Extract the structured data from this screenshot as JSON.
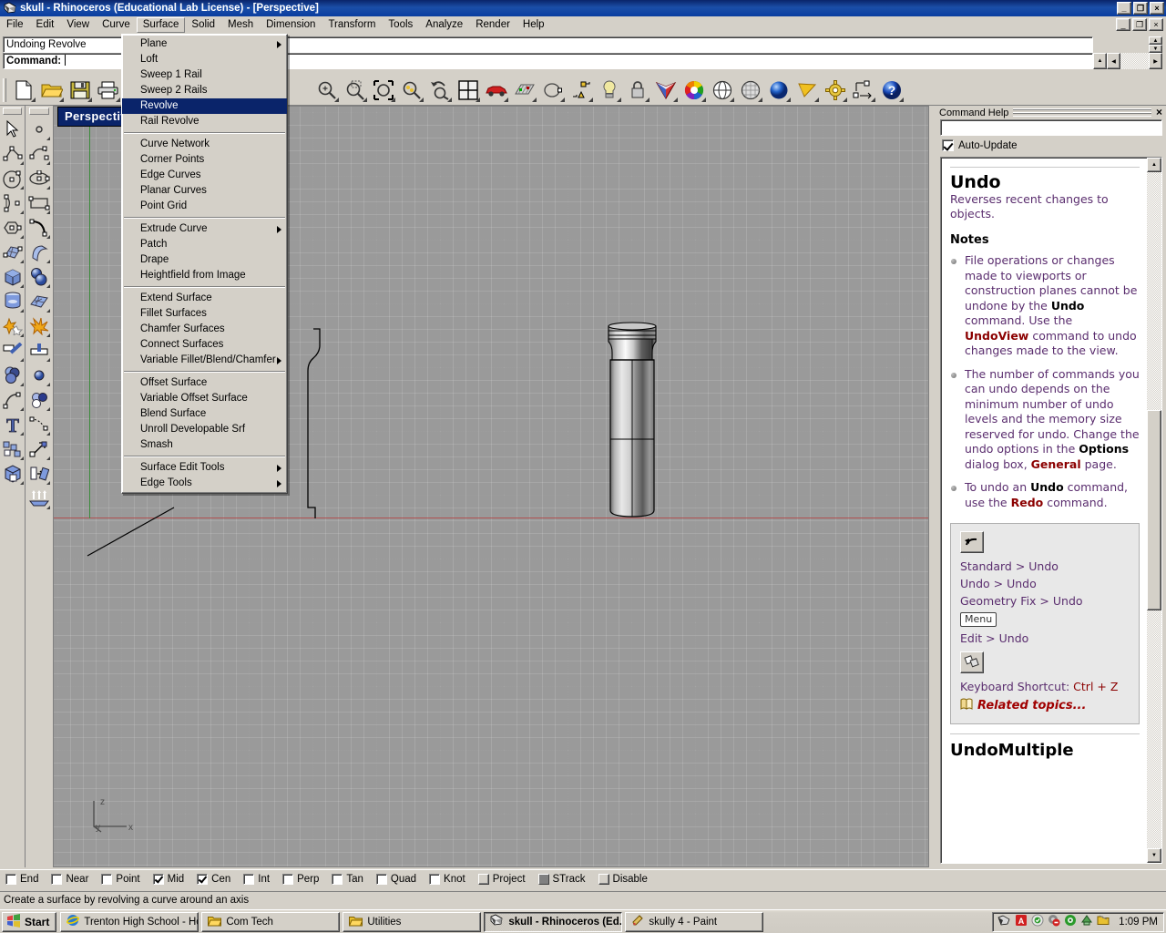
{
  "window": {
    "title": "skull - Rhinoceros (Educational Lab License) - [Perspective]",
    "minimize_label": "_",
    "restore_label": "❐",
    "close_label": "×",
    "mdi_minimize_label": "_",
    "mdi_restore_label": "❐",
    "mdi_close_label": "×"
  },
  "menubar": {
    "items": [
      {
        "label": "File"
      },
      {
        "label": "Edit"
      },
      {
        "label": "View"
      },
      {
        "label": "Curve"
      },
      {
        "label": "Surface",
        "active": true
      },
      {
        "label": "Solid"
      },
      {
        "label": "Mesh"
      },
      {
        "label": "Dimension"
      },
      {
        "label": "Transform"
      },
      {
        "label": "Tools"
      },
      {
        "label": "Analyze"
      },
      {
        "label": "Render"
      },
      {
        "label": "Help"
      }
    ]
  },
  "surface_menu": {
    "items": [
      {
        "label": "Plane",
        "submenu": true
      },
      {
        "label": "Loft"
      },
      {
        "label": "Sweep 1 Rail"
      },
      {
        "label": "Sweep 2 Rails"
      },
      {
        "label": "Revolve",
        "selected": true
      },
      {
        "label": "Rail Revolve"
      },
      {
        "separator": true
      },
      {
        "label": "Curve Network"
      },
      {
        "label": "Corner Points"
      },
      {
        "label": "Edge Curves"
      },
      {
        "label": "Planar Curves"
      },
      {
        "label": "Point Grid"
      },
      {
        "separator": true
      },
      {
        "label": "Extrude Curve",
        "submenu": true
      },
      {
        "label": "Patch"
      },
      {
        "label": "Drape"
      },
      {
        "label": "Heightfield from Image"
      },
      {
        "separator": true
      },
      {
        "label": "Extend Surface"
      },
      {
        "label": "Fillet Surfaces"
      },
      {
        "label": "Chamfer Surfaces"
      },
      {
        "label": "Connect Surfaces"
      },
      {
        "label": "Variable Fillet/Blend/Chamfer",
        "submenu": true
      },
      {
        "separator": true
      },
      {
        "label": "Offset Surface"
      },
      {
        "label": "Variable Offset Surface"
      },
      {
        "label": "Blend Surface"
      },
      {
        "label": "Unroll Developable Srf"
      },
      {
        "label": "Smash"
      },
      {
        "separator": true
      },
      {
        "label": "Surface Edit Tools",
        "submenu": true
      },
      {
        "label": "Edge Tools",
        "submenu": true
      }
    ]
  },
  "command": {
    "history": "Undoing Revolve",
    "prompt": "Command:",
    "input_value": ""
  },
  "toolbar": {
    "buttons": [
      {
        "icon": "new-file-icon"
      },
      {
        "icon": "open-folder-icon"
      },
      {
        "icon": "save-icon"
      },
      {
        "icon": "print-icon"
      },
      {
        "icon": "copy-icon"
      },
      {
        "icon": "cut-icon"
      },
      {
        "icon": "paste-icon"
      },
      {
        "icon": "undo-icon"
      },
      {
        "icon": "redo-icon"
      },
      {
        "icon": "zoom-in-out-icon"
      },
      {
        "icon": "zoom-window-icon"
      },
      {
        "icon": "zoom-extents-icon"
      },
      {
        "icon": "zoom-selected-icon"
      },
      {
        "icon": "zoom-previous-icon"
      },
      {
        "icon": "four-view-icon"
      },
      {
        "icon": "car-render-icon"
      },
      {
        "icon": "grid-snap-icon"
      },
      {
        "icon": "osnap-icon"
      },
      {
        "icon": "layer-icon"
      },
      {
        "icon": "light-bulb-icon"
      },
      {
        "icon": "lock-icon"
      },
      {
        "icon": "shade-icon"
      },
      {
        "icon": "color-wheel-icon"
      },
      {
        "icon": "wireframe-sphere-icon"
      },
      {
        "icon": "ghosted-sphere-icon"
      },
      {
        "icon": "rendered-sphere-icon"
      },
      {
        "icon": "flat-shade-icon"
      },
      {
        "icon": "options-gear-icon"
      },
      {
        "icon": "dimension-icon"
      },
      {
        "icon": "help-icon"
      }
    ]
  },
  "sidebar_left": {
    "tools": [
      {
        "icon": "select-arrow-icon"
      },
      {
        "icon": "polyline-icon"
      },
      {
        "icon": "circle-icon"
      },
      {
        "icon": "arc-icon"
      },
      {
        "icon": "polygon-icon"
      },
      {
        "icon": "surface-patch-icon"
      },
      {
        "icon": "box-icon"
      },
      {
        "icon": "cylinder-icon"
      },
      {
        "icon": "star-explode-icon"
      },
      {
        "icon": "trim-icon"
      },
      {
        "icon": "boolean-union-icon"
      },
      {
        "icon": "curve-edit-icon"
      },
      {
        "icon": "text-tool-icon"
      },
      {
        "icon": "group-icon"
      },
      {
        "icon": "solid-tools-icon"
      }
    ]
  },
  "sidebar_right_col": {
    "tools": [
      {
        "icon": "point-icon"
      },
      {
        "icon": "curve-control-points-icon"
      },
      {
        "icon": "ellipse-icon"
      },
      {
        "icon": "rectangle-icon"
      },
      {
        "icon": "curve-blend-icon"
      },
      {
        "icon": "surface-sweep-icon"
      },
      {
        "icon": "sphere-pair-icon"
      },
      {
        "icon": "mesh-icon"
      },
      {
        "icon": "explode-icon"
      },
      {
        "icon": "split-icon"
      },
      {
        "icon": "dot-icon"
      },
      {
        "icon": "circles-pair-icon"
      },
      {
        "icon": "dim-arc-icon"
      },
      {
        "icon": "move-icon"
      },
      {
        "icon": "rotate-copy-icon"
      },
      {
        "icon": "array-icon"
      }
    ]
  },
  "viewport": {
    "label": "Perspective",
    "axes": {
      "z": "z",
      "y": "y",
      "x": "x"
    },
    "object_description": "revolved cylindrical bottle surface"
  },
  "help_panel": {
    "title": "Command Help",
    "close_label": "×",
    "search_value": "",
    "auto_update_label": "Auto-Update",
    "auto_update_checked": true,
    "heading": "Undo",
    "lead": "Reverses recent changes to objects.",
    "notes_heading": "Notes",
    "notes": [
      {
        "parts": [
          {
            "t": "File operations or changes made to viewports or construction planes cannot be undone by the "
          },
          {
            "t": "Undo",
            "style": "bold"
          },
          {
            "t": " command. Use the "
          },
          {
            "t": "UndoView",
            "style": "kw"
          },
          {
            "t": " command to undo changes made to the view."
          }
        ]
      },
      {
        "parts": [
          {
            "t": "The number of commands you can undo depends on the minimum number of undo levels and the memory size reserved for undo. Change the undo options in the "
          },
          {
            "t": "Options",
            "style": "bold"
          },
          {
            "t": " dialog box, "
          },
          {
            "t": "General",
            "style": "kw"
          },
          {
            "t": " page."
          }
        ]
      },
      {
        "parts": [
          {
            "t": "To undo an "
          },
          {
            "t": "Undo",
            "style": "bold"
          },
          {
            "t": " command, use the "
          },
          {
            "t": "Redo",
            "style": "kw"
          },
          {
            "t": " command."
          }
        ]
      }
    ],
    "shortcuts": {
      "toolbar_paths": [
        "Standard > Undo",
        "Undo > Undo",
        "Geometry Fix > Undo"
      ],
      "menu_badge": "Menu",
      "menu_path": "Edit > Undo",
      "keyboard_label": "Keyboard Shortcut:",
      "keyboard_value": "Ctrl + Z",
      "related_topics": "Related topics..."
    },
    "next_topic": "UndoMultiple"
  },
  "osnap": {
    "items": [
      {
        "label": "End",
        "checked": false
      },
      {
        "label": "Near",
        "checked": false
      },
      {
        "label": "Point",
        "checked": false
      },
      {
        "label": "Mid",
        "checked": true
      },
      {
        "label": "Cen",
        "checked": true
      },
      {
        "label": "Int",
        "checked": false
      },
      {
        "label": "Perp",
        "checked": false
      },
      {
        "label": "Tan",
        "checked": false
      },
      {
        "label": "Quad",
        "checked": false
      },
      {
        "label": "Knot",
        "checked": false
      },
      {
        "label": "Project",
        "checked": false,
        "style": "gray"
      },
      {
        "label": "STrack",
        "checked": false,
        "style": "dark"
      },
      {
        "label": "Disable",
        "checked": false,
        "style": "gray"
      }
    ]
  },
  "statusbar": {
    "text": "Create a surface by revolving a curve around an axis"
  },
  "taskbar": {
    "start_label": "Start",
    "tasks": [
      {
        "label": "Trenton High School - Ho...",
        "icon": "ie-icon",
        "active": false
      },
      {
        "label": "Com Tech",
        "icon": "folder-icon",
        "active": false
      },
      {
        "label": "Utilities",
        "icon": "folder-icon",
        "active": false
      },
      {
        "label": "skull - Rhinoceros (Ed...",
        "icon": "rhino-icon",
        "active": true
      },
      {
        "label": "skully 4 - Paint",
        "icon": "paint-icon",
        "active": false
      }
    ],
    "tray_icons": [
      "rhino-tray-icon",
      "acrobat-tray-icon",
      "shield-tray-icon",
      "audio-mute-icon",
      "green-disc-icon",
      "update-icon",
      "folder-tray-icon"
    ],
    "clock": "1:09 PM"
  },
  "colors": {
    "titlebar_start": "#0a246a",
    "titlebar_end": "#1b4fa8",
    "chrome": "#d4d0c8",
    "viewport_bg": "#9a9a9a",
    "axis_x": "#b05050",
    "axis_y": "#3c8c3c",
    "menu_highlight": "#0a246a",
    "help_text": "#5a2d6e",
    "help_keyword": "#8b0000"
  }
}
